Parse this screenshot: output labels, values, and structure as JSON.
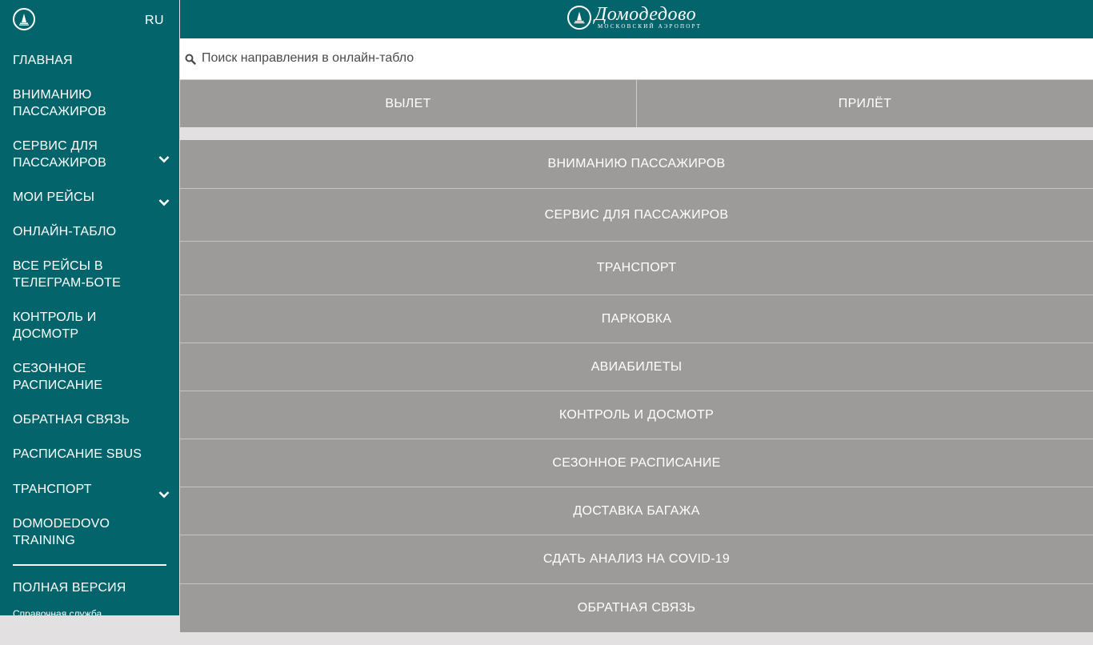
{
  "sidebar": {
    "lang": "RU",
    "items": [
      {
        "label": "Главная"
      },
      {
        "label": "Вниманию пассажиров"
      },
      {
        "label": "Сервис для пассажиров",
        "expandable": true
      },
      {
        "label": "Мои рейсы",
        "expandable": true
      },
      {
        "label": "Онлайн-табло"
      },
      {
        "label": "Все рейсы в Телеграм-боте"
      },
      {
        "label": "Контроль и досмотр"
      },
      {
        "label": "Сезонное расписание"
      },
      {
        "label": "Обратная связь"
      },
      {
        "label": "Расписание SBUS"
      },
      {
        "label": "Транспорт",
        "expandable": true
      },
      {
        "label": "Domodedovo Training"
      }
    ],
    "full_version": "Полная версия",
    "helpdesk": "Справочная служба"
  },
  "header": {
    "brand_name": "Домодедово",
    "brand_sub": "Московский аэропорт"
  },
  "search": {
    "placeholder": "Поиск направления в онлайн-табло",
    "icon": "search-icon"
  },
  "tabs": [
    "Вылет",
    "Прилёт"
  ],
  "menu": [
    "Вниманию пассажиров",
    "Сервис для пассажиров",
    "Транспорт",
    "Парковка",
    "Авиабилеты",
    "Контроль и досмотр",
    "Сезонное расписание",
    "Доставка багажа",
    "Сдать анализ на COVID-19",
    "Обратная связь"
  ],
  "colors": {
    "brand": "#03656b",
    "panel": "#9d9b99",
    "background": "#e2e0e0"
  }
}
